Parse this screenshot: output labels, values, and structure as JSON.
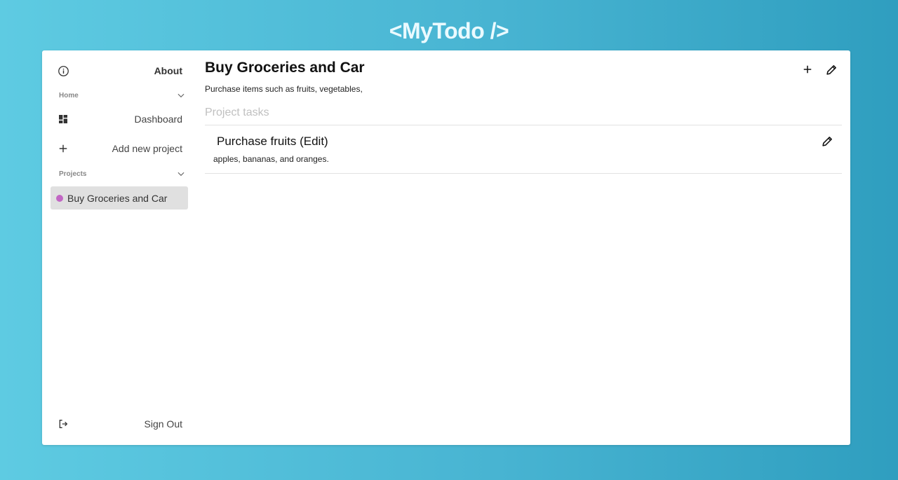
{
  "brand": "<MyTodo />",
  "sidebar": {
    "about_label": "About",
    "home_section": "Home",
    "dashboard_label": "Dashboard",
    "add_project_label": "Add new project",
    "projects_section": "Projects",
    "projects": [
      {
        "name": "Buy Groceries and Car",
        "color": "#c267c4"
      }
    ],
    "sign_out_label": "Sign Out"
  },
  "main": {
    "project_title": "Buy Groceries and Car",
    "project_description": "Purchase items such as fruits, vegetables,",
    "tasks_heading": "Project tasks",
    "tasks": [
      {
        "title": "Purchase fruits (Edit)",
        "description": "apples, bananas, and oranges."
      }
    ]
  },
  "icons": {
    "about": "info-icon",
    "dashboard": "dashboard-icon",
    "add": "plus-icon",
    "sign_out": "logout-icon",
    "edit": "pencil-icon",
    "chevron": "chevron-down-icon"
  }
}
